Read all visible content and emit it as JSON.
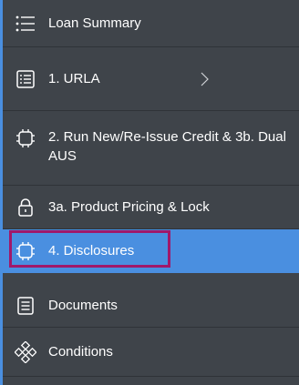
{
  "nav": {
    "items": [
      {
        "label": "Loan Summary",
        "icon": "list-icon"
      },
      {
        "label": "1. URLA",
        "icon": "form-icon",
        "has_submenu": true
      },
      {
        "label": "2. Run New/Re-Issue Credit & 3b. Dual AUS",
        "icon": "chip-icon"
      },
      {
        "label": "3a. Product Pricing & Lock",
        "icon": "lock-icon"
      },
      {
        "label": "4. Disclosures",
        "icon": "chip-icon",
        "active": true
      },
      {
        "label": "Documents",
        "icon": "document-icon"
      },
      {
        "label": "Conditions",
        "icon": "conditions-icon"
      }
    ]
  },
  "colors": {
    "background": "#3f444a",
    "active": "#4a8fe0",
    "highlight_border": "#a0186a",
    "text": "#ffffff"
  }
}
